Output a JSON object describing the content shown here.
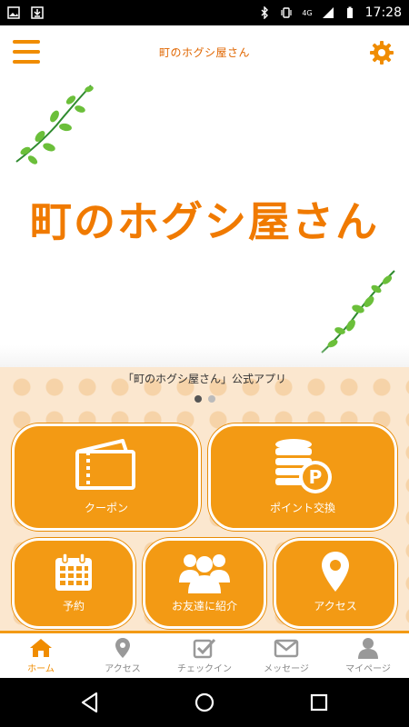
{
  "status_bar": {
    "time": "17:28",
    "network": "4G",
    "icons": [
      "image-icon",
      "download-icon",
      "bluetooth-icon",
      "vibrate-icon",
      "signal-icon",
      "battery-icon"
    ]
  },
  "header": {
    "title": "町のホグシ屋さん",
    "menu_icon": "hamburger-menu-icon",
    "settings_icon": "gear-icon"
  },
  "hero": {
    "logo_text": "町のホグシ屋さん"
  },
  "carousel": {
    "caption": "「町のホグシ屋さん」公式アプリ",
    "pages": 2,
    "active_page": 1
  },
  "tiles": [
    {
      "label": "クーポン",
      "icon": "ticket-icon"
    },
    {
      "label": "ポイント交換",
      "icon": "coins-point-icon"
    },
    {
      "label": "予約",
      "icon": "calendar-icon"
    },
    {
      "label": "お友達に紹介",
      "icon": "people-group-icon"
    },
    {
      "label": "アクセス",
      "icon": "map-pin-icon"
    }
  ],
  "bottom_nav": [
    {
      "label": "ホーム",
      "icon": "home-icon",
      "active": true
    },
    {
      "label": "アクセス",
      "icon": "map-pin-icon",
      "active": false
    },
    {
      "label": "チェックイン",
      "icon": "checkbox-icon",
      "active": false
    },
    {
      "label": "メッセージ",
      "icon": "envelope-icon",
      "active": false
    },
    {
      "label": "マイページ",
      "icon": "user-icon",
      "active": false
    }
  ],
  "colors": {
    "accent": "#f39a14",
    "accent_dark": "#e06600",
    "pattern_bg": "#fbe7cf",
    "pattern_dot": "#f6d3a8"
  }
}
